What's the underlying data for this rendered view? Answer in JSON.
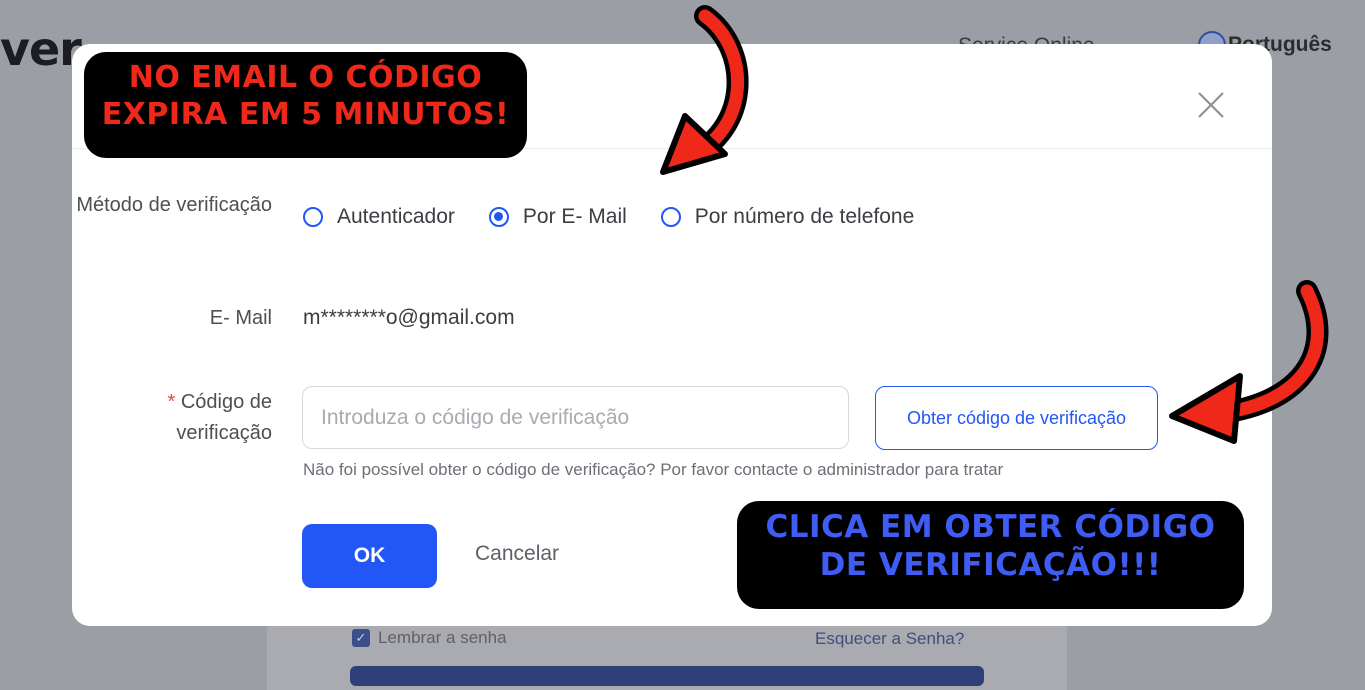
{
  "background_page": {
    "logo_fragment": "ver",
    "support_text": "Service Online",
    "language": "Português",
    "remember_password": "Lembrar a senha",
    "forgot_password": "Esquecer a Senha?"
  },
  "modal": {
    "verification_method_label": "Método de verificação",
    "methods": [
      {
        "label": "Autenticador",
        "selected": false
      },
      {
        "label": "Por E- Mail",
        "selected": true
      },
      {
        "label": "Por número de telefone",
        "selected": false
      }
    ],
    "email_label": "E- Mail",
    "email_value": "m********o@gmail.com",
    "code_label_required": "*",
    "code_label": "Código de verificação",
    "code_placeholder": "Introduza o código de verificação",
    "get_code_button": "Obter código de verificação",
    "help_text": "Não foi possível obter o código de verificação? Por favor contacte o administrador para tratar",
    "ok_button": "OK",
    "cancel_button": "Cancelar"
  },
  "annotations": {
    "red_note": "NO EMAIL O CÓDIGO EXPIRA EM 5 MINUTOS!",
    "blue_note": "CLICA EM OBTER CÓDIGO DE VERIFICAÇÃO!!!"
  },
  "colors": {
    "accent": "#2356f6",
    "overlay_red": "#f0281a",
    "overlay_blue": "#3f5cf5"
  }
}
